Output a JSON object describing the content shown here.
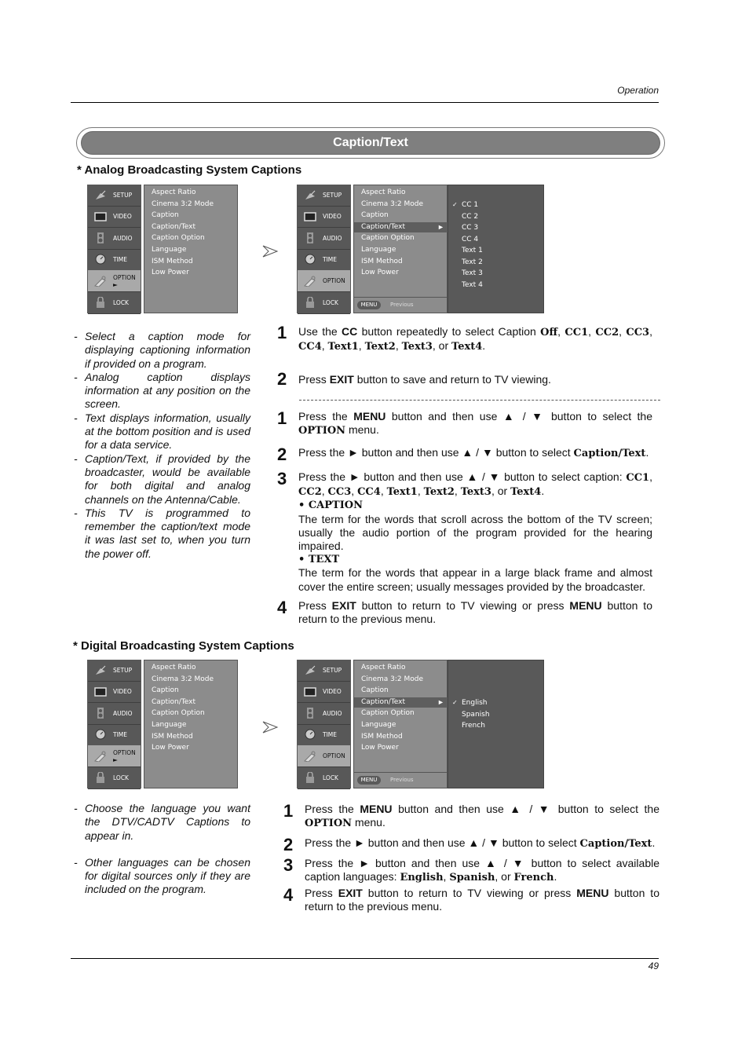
{
  "page": {
    "header_label": "Operation",
    "page_number": "49",
    "title": "Caption/Text"
  },
  "analog": {
    "heading": "* Analog Broadcasting System Captions",
    "notes": [
      "Select a caption mode for displaying captioning information if provided on a program.",
      "Analog caption displays information at any position on the screen.",
      "Text displays information, usually at the bottom position and is used for a data service.",
      "Caption/Text, if provided by the broadcaster, would be available for both digital and analog channels on the Antenna/Cable.",
      "This TV is programmed to remember the caption/text mode it was last set to, when you turn the power off."
    ],
    "cc_steps": {
      "s1": {
        "num": "1",
        "a": "Use the ",
        "b1": "CC",
        "c": " button repeatedly to select Caption ",
        "opts": [
          "Off",
          "CC1",
          "CC2",
          "CC3",
          "CC4",
          "Text1",
          "Text2",
          "Text3",
          "Text4"
        ],
        "or": "or"
      },
      "s2": {
        "num": "2",
        "a": "Press ",
        "b1": "EXIT",
        "c": " button to save and return to TV viewing."
      }
    },
    "menu_steps": {
      "s1": {
        "num": "1",
        "a": "Press the ",
        "b1": "MENU",
        "c": " button and then use ▲ / ▼  button to select the ",
        "b2": "OPTION",
        "d": " menu."
      },
      "s2": {
        "num": "2",
        "a": "Press the ► button and then use ▲ / ▼ button to select ",
        "b1": "Caption/Text",
        "d": "."
      },
      "s3": {
        "num": "3",
        "a": "Press the ► button and then use ▲ / ▼ button to select caption: ",
        "opts": [
          "CC1",
          "CC2",
          "CC3",
          "CC4",
          "Text1",
          "Text2",
          "Text3",
          "Text4"
        ],
        "or": "or",
        "caption_head": "• CAPTION",
        "caption_body": "The term for the words that scroll across the bottom of the TV screen; usually the audio portion of the program provided for the hearing impaired.",
        "text_head": "• TEXT",
        "text_body": "The term for the words that appear in a large black frame and almost cover the entire screen; usually messages provided by the broadcaster."
      },
      "s4": {
        "num": "4",
        "a": "Press ",
        "b1": "EXIT",
        "c": " button to return to TV viewing or press ",
        "b2": "MENU",
        "d": " button to return to the previous menu."
      }
    }
  },
  "digital": {
    "heading": "* Digital Broadcasting System Captions",
    "notes": [
      "Choose the language you want the DTV/CADTV Captions to appear in.",
      "Other languages can be chosen for digital sources only if they are included on the program."
    ],
    "steps": {
      "s1": {
        "num": "1",
        "a": "Press the ",
        "b1": "MENU",
        "c": " button and then use ▲ / ▼  button to select the ",
        "b2": "OPTION",
        "d": " menu."
      },
      "s2": {
        "num": "2",
        "a": "Press the ► button and then use ▲ / ▼ button to select ",
        "b1": "Caption/Text",
        "d": "."
      },
      "s3": {
        "num": "3",
        "a": "Press the ► button and then use ▲ / ▼ button to select available caption languages: ",
        "b1": "English",
        "sep1": ", ",
        "b2": "Spanish",
        "sep2": ", or ",
        "b3": "French",
        "d": "."
      },
      "s4": {
        "num": "4",
        "a": "Press ",
        "b1": "EXIT",
        "c": " button to return to TV viewing or press ",
        "b2": "MENU",
        "d": " button to return to the previous menu."
      }
    }
  },
  "tv_menu": {
    "tabs": [
      {
        "label": "SETUP",
        "icon": "satellite-dish-icon"
      },
      {
        "label": "VIDEO",
        "icon": "monitor-icon"
      },
      {
        "label": "AUDIO",
        "icon": "speaker-icon"
      },
      {
        "label": "TIME",
        "icon": "clock-icon"
      },
      {
        "label": "OPTION",
        "icon": "tag-icon"
      },
      {
        "label": "LOCK",
        "icon": "padlock-icon"
      }
    ],
    "option_arrow": "►",
    "items": [
      "Aspect Ratio",
      "Cinema 3:2 Mode",
      "Caption",
      "Caption/Text",
      "Caption Option",
      "Language",
      "ISM Method",
      "Low Power"
    ],
    "highlighted": "Caption/Text",
    "footer_button": "MENU",
    "footer_label": "Previous",
    "checkmark": "✓",
    "analog_options": [
      "CC 1",
      "CC 2",
      "CC 3",
      "CC 4",
      "Text 1",
      "Text 2",
      "Text 3",
      "Text 4"
    ],
    "analog_selected": "CC 1",
    "digital_options": [
      "English",
      "Spanish",
      "French"
    ],
    "digital_selected": "English"
  }
}
